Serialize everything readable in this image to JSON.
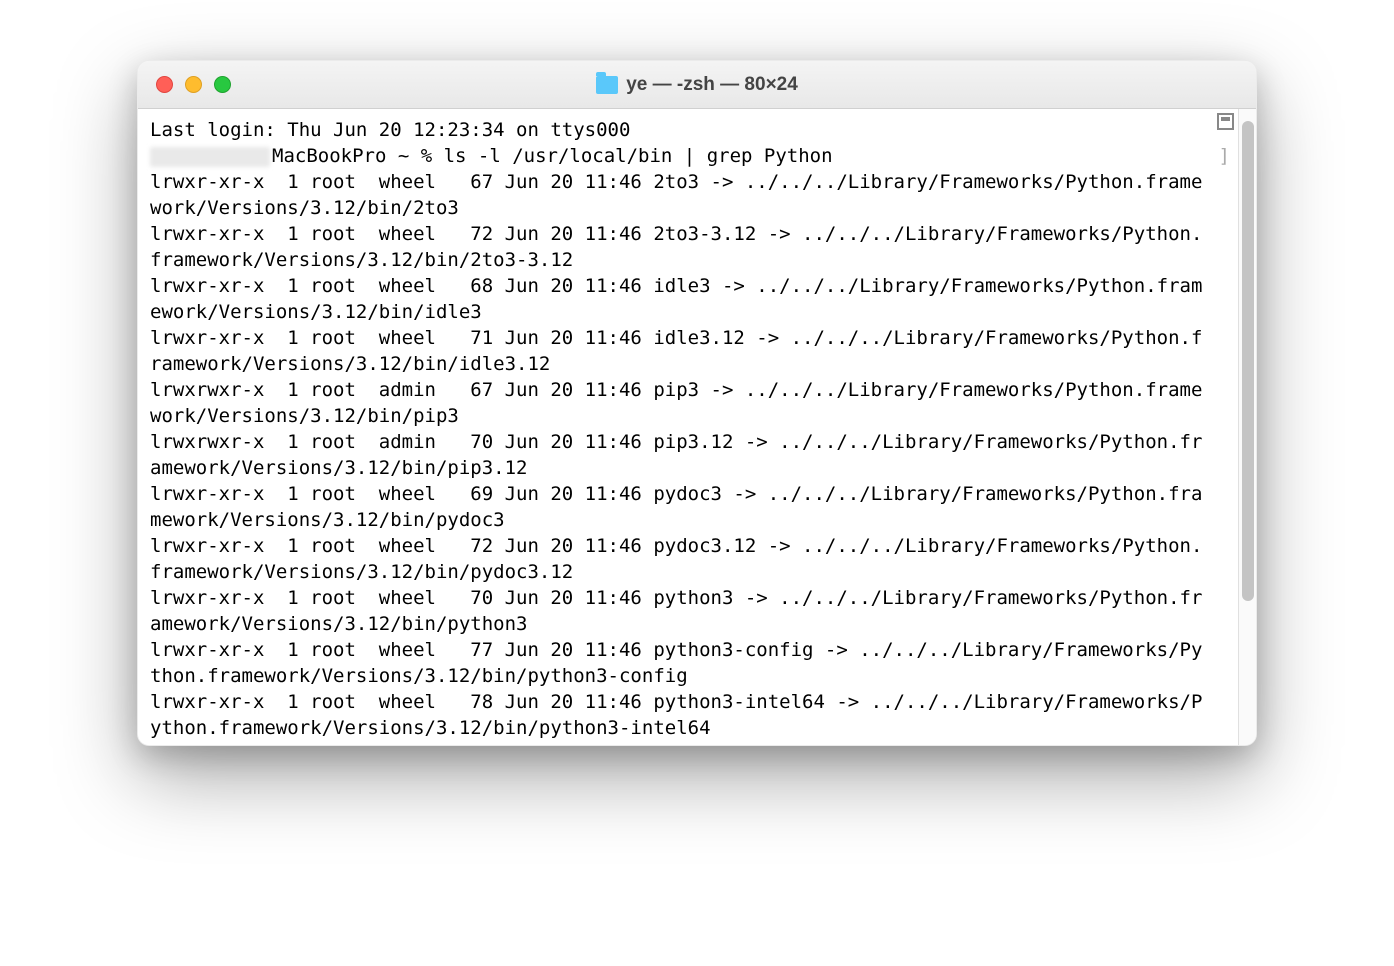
{
  "window": {
    "title": "ye — -zsh — 80×24"
  },
  "terminal": {
    "last_login": "Last login: Thu Jun 20 12:23:34 on ttys000",
    "prompt_host": "MacBookPro ~ % ",
    "command": "ls -l /usr/local/bin | grep Python",
    "right_bracket": "]",
    "lines": [
      "lrwxr-xr-x  1 root  wheel   67 Jun 20 11:46 2to3 -> ../../../Library/Frameworks/Python.framework/Versions/3.12/bin/2to3",
      "lrwxr-xr-x  1 root  wheel   72 Jun 20 11:46 2to3-3.12 -> ../../../Library/Frameworks/Python.framework/Versions/3.12/bin/2to3-3.12",
      "lrwxr-xr-x  1 root  wheel   68 Jun 20 11:46 idle3 -> ../../../Library/Frameworks/Python.framework/Versions/3.12/bin/idle3",
      "lrwxr-xr-x  1 root  wheel   71 Jun 20 11:46 idle3.12 -> ../../../Library/Frameworks/Python.framework/Versions/3.12/bin/idle3.12",
      "lrwxrwxr-x  1 root  admin   67 Jun 20 11:46 pip3 -> ../../../Library/Frameworks/Python.framework/Versions/3.12/bin/pip3",
      "lrwxrwxr-x  1 root  admin   70 Jun 20 11:46 pip3.12 -> ../../../Library/Frameworks/Python.framework/Versions/3.12/bin/pip3.12",
      "lrwxr-xr-x  1 root  wheel   69 Jun 20 11:46 pydoc3 -> ../../../Library/Frameworks/Python.framework/Versions/3.12/bin/pydoc3",
      "lrwxr-xr-x  1 root  wheel   72 Jun 20 11:46 pydoc3.12 -> ../../../Library/Frameworks/Python.framework/Versions/3.12/bin/pydoc3.12",
      "lrwxr-xr-x  1 root  wheel   70 Jun 20 11:46 python3 -> ../../../Library/Frameworks/Python.framework/Versions/3.12/bin/python3",
      "lrwxr-xr-x  1 root  wheel   77 Jun 20 11:46 python3-config -> ../../../Library/Frameworks/Python.framework/Versions/3.12/bin/python3-config",
      "lrwxr-xr-x  1 root  wheel   78 Jun 20 11:46 python3-intel64 -> ../../../Library/Frameworks/Python.framework/Versions/3.12/bin/python3-intel64"
    ]
  }
}
